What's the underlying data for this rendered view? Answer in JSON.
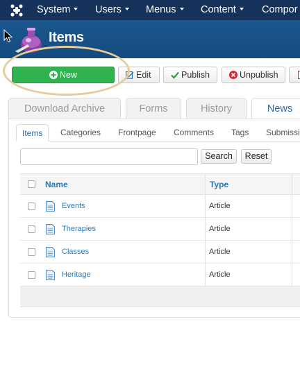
{
  "topnav": {
    "items": [
      {
        "label": "System"
      },
      {
        "label": "Users"
      },
      {
        "label": "Menus"
      },
      {
        "label": "Content"
      },
      {
        "label": "Compor"
      }
    ]
  },
  "header": {
    "title": "Items"
  },
  "toolbar": {
    "new_label": "New",
    "edit_label": "Edit",
    "publish_label": "Publish",
    "unpublish_label": "Unpublish"
  },
  "tabs": [
    {
      "label": "Download Archive"
    },
    {
      "label": "Forms"
    },
    {
      "label": "History"
    },
    {
      "label": "News",
      "active": true
    }
  ],
  "subtabs": [
    {
      "label": "Items",
      "active": true
    },
    {
      "label": "Categories"
    },
    {
      "label": "Frontpage"
    },
    {
      "label": "Comments"
    },
    {
      "label": "Tags"
    },
    {
      "label": "Submissi"
    }
  ],
  "search": {
    "value": "",
    "search_label": "Search",
    "reset_label": "Reset"
  },
  "table": {
    "columns": [
      "Name",
      "Type"
    ],
    "rows": [
      {
        "name": "Events",
        "type": "Article"
      },
      {
        "name": "Therapies",
        "type": "Article"
      },
      {
        "name": "Classes",
        "type": "Article"
      },
      {
        "name": "Heritage",
        "type": "Article"
      }
    ]
  },
  "colors": {
    "nav_bg": "#15325a",
    "header_bg": "#1a5890",
    "new_button": "#2fb24f",
    "unpublish_icon": "#d9272e",
    "highlight_ring": "#e6cc9c",
    "link": "#2a7ab8"
  },
  "icons": {
    "logo": "joomla-logo-icon",
    "items": "ink-bottle-icon",
    "new": "plus-circle-icon",
    "edit": "edit-icon",
    "publish": "check-icon",
    "unpublish": "x-circle-icon",
    "row": "document-icon"
  }
}
